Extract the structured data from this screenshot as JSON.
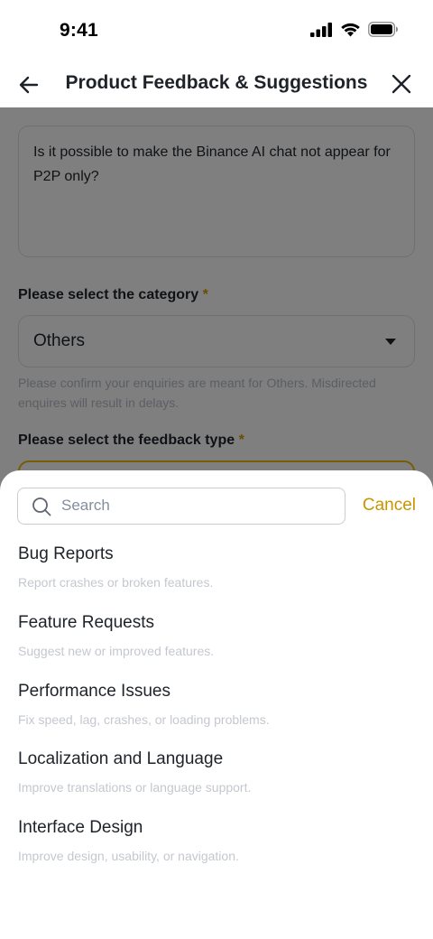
{
  "status_bar": {
    "time": "9:41"
  },
  "nav": {
    "title": "Product Feedback & Suggestions"
  },
  "form": {
    "feedback_text": "Is it possible to make the Binance AI chat not appear for P2P only?",
    "category_label": "Please select the category",
    "required_mark": "*",
    "category_value": "Others",
    "category_hint": "Please confirm your enquiries are meant for Others. Misdirected enquires will result in delays.",
    "feedback_type_label": "Please select the feedback type"
  },
  "sheet": {
    "search_placeholder": "Search",
    "cancel_label": "Cancel",
    "options": [
      {
        "title": "Bug Reports",
        "desc": "Report crashes or broken features."
      },
      {
        "title": "Feature Requests",
        "desc": "Suggest new or improved features."
      },
      {
        "title": "Performance Issues",
        "desc": "Fix speed, lag, crashes, or loading problems."
      },
      {
        "title": "Localization and Language",
        "desc": "Improve translations or language support."
      },
      {
        "title": "Interface Design",
        "desc": "Improve design, usability, or navigation."
      }
    ]
  },
  "icons": {
    "back": "back-arrow-icon",
    "close": "close-icon",
    "search": "search-icon",
    "dropdown": "caret-down-icon"
  },
  "colors": {
    "accent": "#F0B90B",
    "cancel_text": "#C99400",
    "required": "#D89B00",
    "text_primary": "#1E2329",
    "text_muted": "#B7BDC6"
  }
}
